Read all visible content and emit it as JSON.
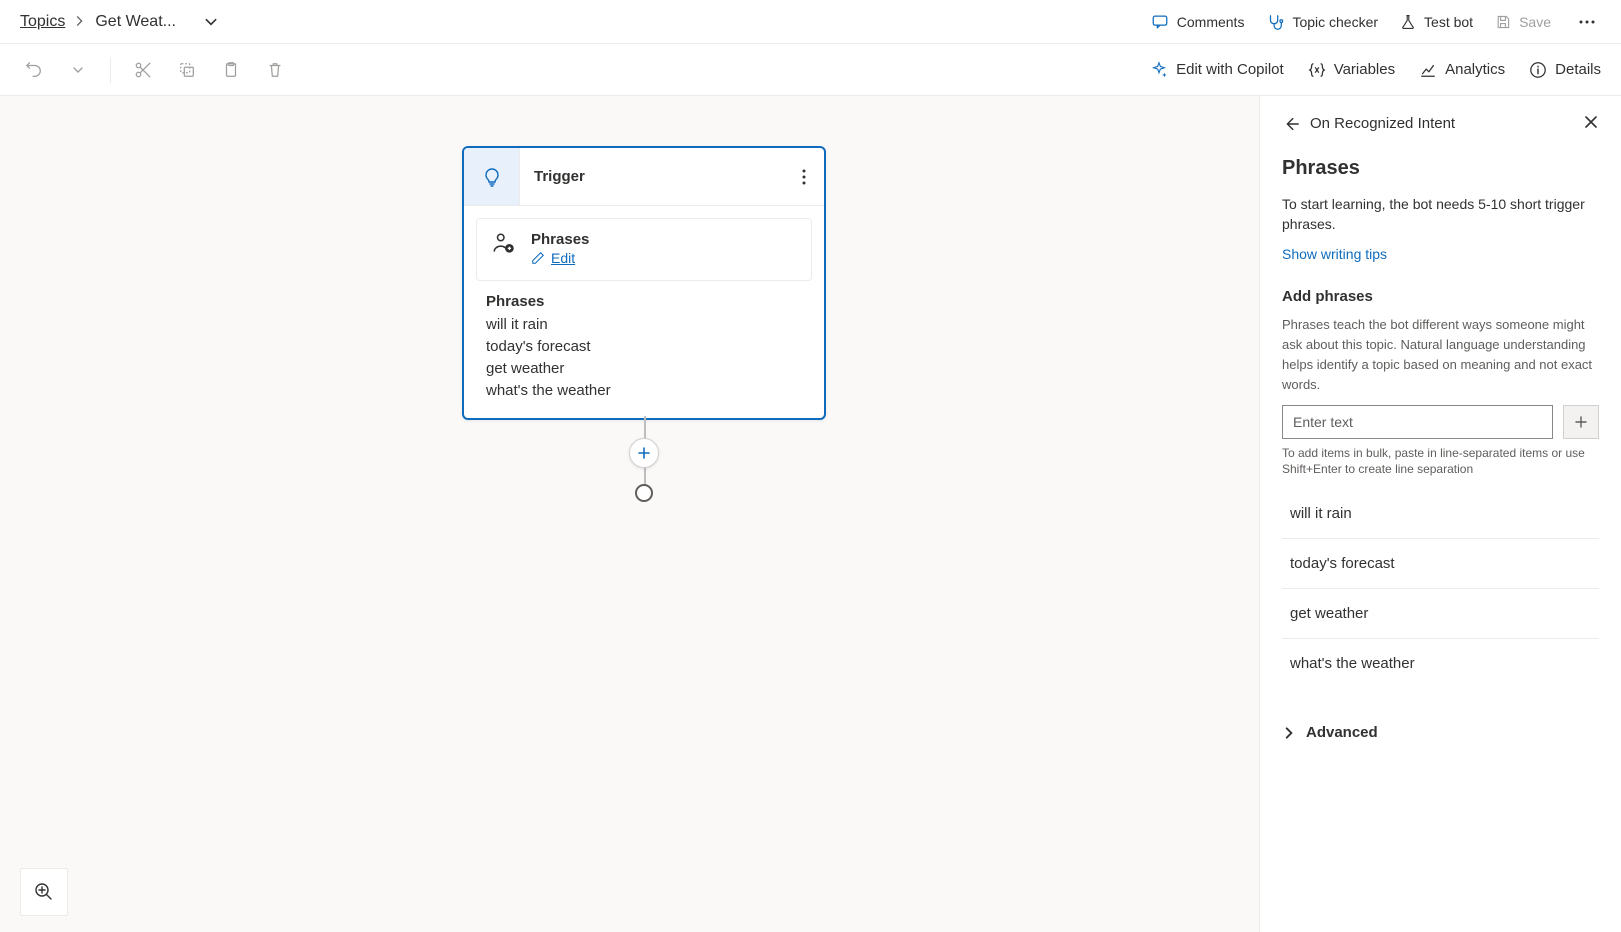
{
  "breadcrumb": {
    "root": "Topics",
    "current": "Get Weat..."
  },
  "header": {
    "comments": "Comments",
    "topic_checker": "Topic checker",
    "test_bot": "Test bot",
    "save": "Save"
  },
  "toolbar": {
    "edit_copilot": "Edit with Copilot",
    "variables": "Variables",
    "analytics": "Analytics",
    "details": "Details"
  },
  "node": {
    "title": "Trigger",
    "card_title": "Phrases",
    "edit": "Edit",
    "list_title": "Phrases",
    "phrases": [
      "will it rain",
      "today's forecast",
      "get weather",
      "what's the weather"
    ]
  },
  "panel": {
    "back_title": "On Recognized Intent",
    "heading": "Phrases",
    "lead": "To start learning, the bot needs 5-10 short trigger phrases.",
    "tips_link": "Show writing tips",
    "add_title": "Add phrases",
    "add_desc": "Phrases teach the bot different ways someone might ask about this topic. Natural language understanding helps identify a topic based on meaning and not exact words.",
    "input_placeholder": "Enter text",
    "bulk_hint": "To add items in bulk, paste in line-separated items or use Shift+Enter to create line separation",
    "phrases": [
      "will it rain",
      "today's forecast",
      "get weather",
      "what's the weather"
    ],
    "advanced": "Advanced"
  }
}
